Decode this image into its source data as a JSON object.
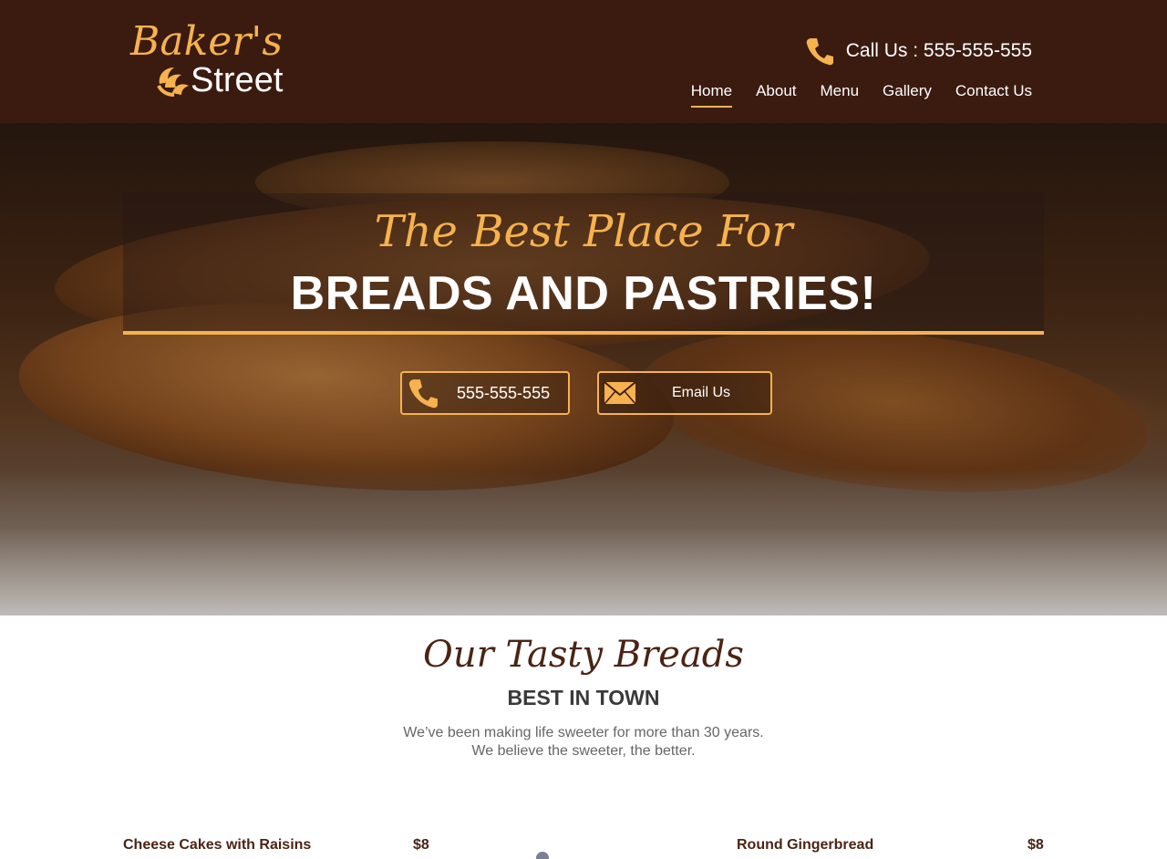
{
  "brand": {
    "logo_line1": "Baker's",
    "logo_line2": "Street",
    "accent_color": "#f6b24f",
    "header_bg": "#3b1b10"
  },
  "header": {
    "call_label": "Call Us : 555-555-555",
    "call_icon": "phone-icon"
  },
  "nav": {
    "items": [
      {
        "label": "Home",
        "active": true
      },
      {
        "label": "About",
        "active": false
      },
      {
        "label": "Menu",
        "active": false
      },
      {
        "label": "Gallery",
        "active": false
      },
      {
        "label": "Contact Us",
        "active": false
      }
    ]
  },
  "hero": {
    "script_text": "The Best Place For",
    "title": "BREADS AND PASTRIES!",
    "phone_button": {
      "label": "555-555-555",
      "icon": "phone-icon"
    },
    "email_button": {
      "label": "Email Us",
      "icon": "envelope-icon"
    }
  },
  "section": {
    "script_title": "Our Tasty Breads",
    "subtitle": "BEST IN TOWN",
    "desc_line1": "We’ve been making life sweeter for more than 30 years.",
    "desc_line2": "We believe the sweeter, the better."
  },
  "menu": {
    "left": {
      "name": "Cheese Cakes with Raisins",
      "price": "$8"
    },
    "right": {
      "name": "Round Gingerbread",
      "price": "$8"
    }
  }
}
